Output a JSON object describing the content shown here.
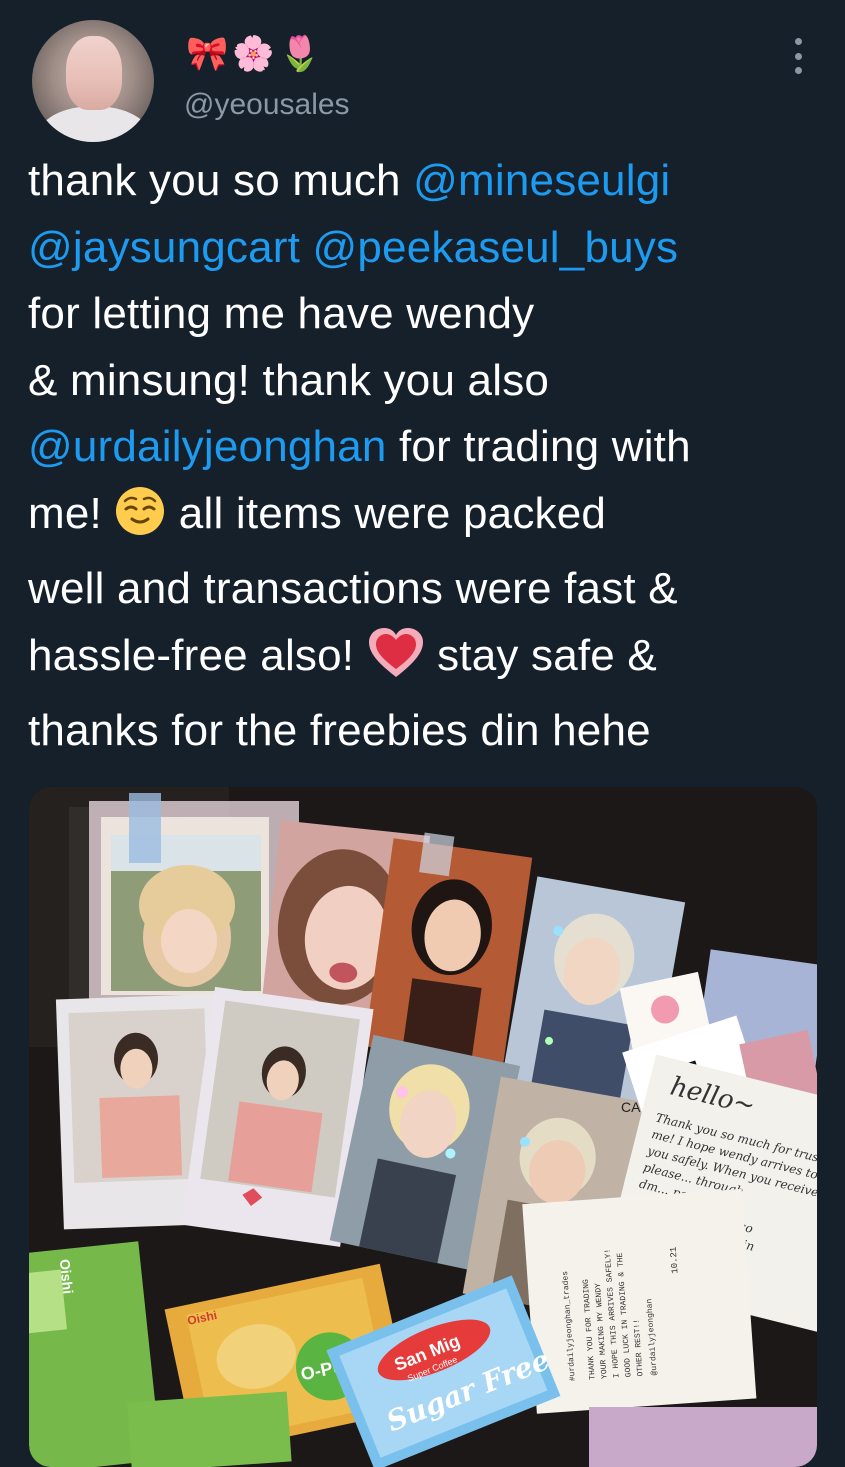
{
  "user": {
    "display_name": "🎀🌸🌷",
    "handle": "@yeousales"
  },
  "tweet": {
    "t1": "thank you so much ",
    "m1": "@mineseulgi",
    "m2": "@jaysungcart",
    "sp": " ",
    "m3": "@peekaseul_buys",
    "t2": "for letting me have wendy",
    "t3": "& minsung! thank you also",
    "m4": "@urdailyjeonghan",
    "t4": " for trading with",
    "t5": "me! ",
    "e1": "relieved-face-emoji",
    "t6": " all items were packed",
    "t7": "well and transactions were fast &",
    "t8": "hassle-free also! ",
    "e2": "growing-heart-emoji",
    "t9": " stay safe &",
    "t10": "thanks for the freebies din hehe"
  },
  "photo": {
    "note_hello": "hello~",
    "note_lines": [
      "Thank you so much for trustin",
      "me! I hope wendy arrives to",
      "you safely. When you receive this",
      "please... through",
      "dm... peekaseul~",
      "Also",
      "in"
    ],
    "card_lines": [
      "THANK YOU FOR TRADING",
      "YOUR MAKING MY WENDY",
      "I HOPE THIS ARRIVES SAFELY!",
      "GOOD LUCK IN TRADING & THE",
      "OTHER REST!!",
      "@urdailyjeonghan"
    ],
    "card_tag": "#urdailyjeonghan_trades",
    "card_date": "10.21",
    "snack_oishi": "Oishi",
    "snack_puff": "O-Puff",
    "sanmig": "San Mig",
    "sanmig_sub": "Super Coffee",
    "sugar": "Sugar Free",
    "stamp": "CA"
  },
  "colors": {
    "background": "#15202b",
    "text": "#ffffff",
    "secondary": "#8b98a5",
    "link": "#1d9bf0"
  }
}
